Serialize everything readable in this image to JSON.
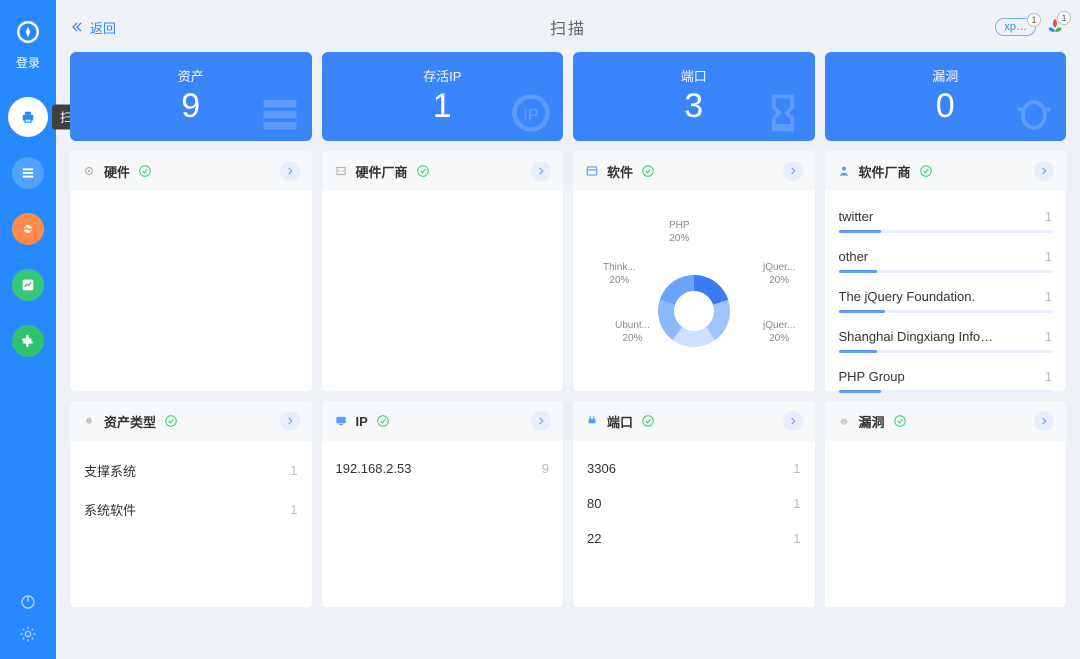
{
  "sidebar": {
    "login_label": "登录",
    "tooltip_scan": "扫描"
  },
  "header": {
    "back_label": "返回",
    "title": "扫描",
    "xp_label": "xp…",
    "xp_badge": "1",
    "tri_badge": "1"
  },
  "stats": [
    {
      "label": "资产",
      "value": "9"
    },
    {
      "label": "存活IP",
      "value": "1"
    },
    {
      "label": "端口",
      "value": "3"
    },
    {
      "label": "漏洞",
      "value": "0"
    }
  ],
  "panels_top": {
    "hardware": {
      "title": "硬件"
    },
    "hardware_vendor": {
      "title": "硬件厂商"
    },
    "software": {
      "title": "软件"
    },
    "software_vendor": {
      "title": "软件厂商",
      "items": [
        {
          "name": "twitter",
          "count": "1",
          "pct": 20
        },
        {
          "name": "other",
          "count": "1",
          "pct": 18
        },
        {
          "name": "The jQuery Foundation.",
          "count": "1",
          "pct": 22
        },
        {
          "name": "Shanghai Dingxiang Info…",
          "count": "1",
          "pct": 18
        },
        {
          "name": "PHP Group",
          "count": "1",
          "pct": 20
        }
      ]
    }
  },
  "panels_bottom": {
    "asset_type": {
      "title": "资产类型",
      "items": [
        {
          "name": "支撑系统",
          "count": "1"
        },
        {
          "name": "系统软件",
          "count": "1"
        }
      ]
    },
    "ip": {
      "title": "IP",
      "items": [
        {
          "name": "192.168.2.53",
          "count": "9"
        }
      ]
    },
    "port": {
      "title": "端口",
      "items": [
        {
          "name": "3306",
          "count": "1"
        },
        {
          "name": "80",
          "count": "1"
        },
        {
          "name": "22",
          "count": "1"
        }
      ]
    },
    "vuln": {
      "title": "漏洞",
      "items": []
    }
  },
  "chart_data": {
    "type": "pie",
    "title": "软件",
    "series": [
      {
        "name": "PHP",
        "value": 20,
        "label": "20%"
      },
      {
        "name": "jQuer...",
        "value": 20,
        "label": "20%"
      },
      {
        "name": "jQuer...",
        "value": 20,
        "label": "20%"
      },
      {
        "name": "Ubunt...",
        "value": 20,
        "label": "20%"
      },
      {
        "name": "Think...",
        "value": 20,
        "label": "20%"
      }
    ]
  }
}
